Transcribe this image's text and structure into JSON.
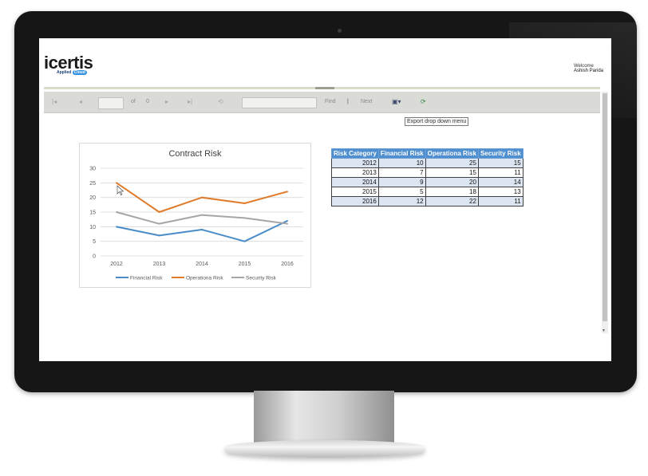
{
  "brand": {
    "logo_text": "icertis",
    "logo_sub": "Applied",
    "logo_badge": "Cloud"
  },
  "user": {
    "welcome_label": "Welcome",
    "name": "Ashish Parida"
  },
  "toolbar": {
    "first_page": "|◂",
    "prev_page": "◂",
    "page_value": "",
    "of_label": "of",
    "total_pages": "0",
    "next_page": "▸",
    "last_page": "▸|",
    "back": "⟲",
    "search_value": "",
    "find_label": "Find",
    "separator": "|",
    "next_label": "Next",
    "export_glyph": "▣▾",
    "refresh_glyph": "⟳"
  },
  "tooltip": {
    "text": "Export drop down menu"
  },
  "colors": {
    "financial": "#4a8cc8",
    "operational": "#df7b2a",
    "security": "#a6a6a6",
    "table_header": "#4f8fd0",
    "table_alt_row": "#dce6f2"
  },
  "chart_data": {
    "type": "line",
    "title": "Contract Risk",
    "categories": [
      "2012",
      "2013",
      "2014",
      "2015",
      "2016"
    ],
    "ylim": [
      0,
      30
    ],
    "yticks": [
      "0",
      "5",
      "10",
      "15",
      "20",
      "25",
      "30"
    ],
    "grid": true,
    "legend_position": "bottom",
    "series": [
      {
        "name": "Financial Risk",
        "color": "#4a8cc8",
        "values": [
          10,
          7,
          9,
          5,
          12
        ]
      },
      {
        "name": "Operationa Risk",
        "color": "#df7b2a",
        "values": [
          25,
          15,
          20,
          18,
          22
        ]
      },
      {
        "name": "Security Risk",
        "color": "#a6a6a6",
        "values": [
          15,
          11,
          14,
          13,
          11
        ]
      }
    ]
  },
  "table": {
    "headers": [
      "Risk Category",
      "Financial Risk",
      "Operationa Risk",
      "Security Risk"
    ],
    "rows": [
      [
        "2012",
        "10",
        "25",
        "15"
      ],
      [
        "2013",
        "7",
        "15",
        "11"
      ],
      [
        "2014",
        "9",
        "20",
        "14"
      ],
      [
        "2015",
        "5",
        "18",
        "13"
      ],
      [
        "2016",
        "12",
        "22",
        "11"
      ]
    ]
  }
}
